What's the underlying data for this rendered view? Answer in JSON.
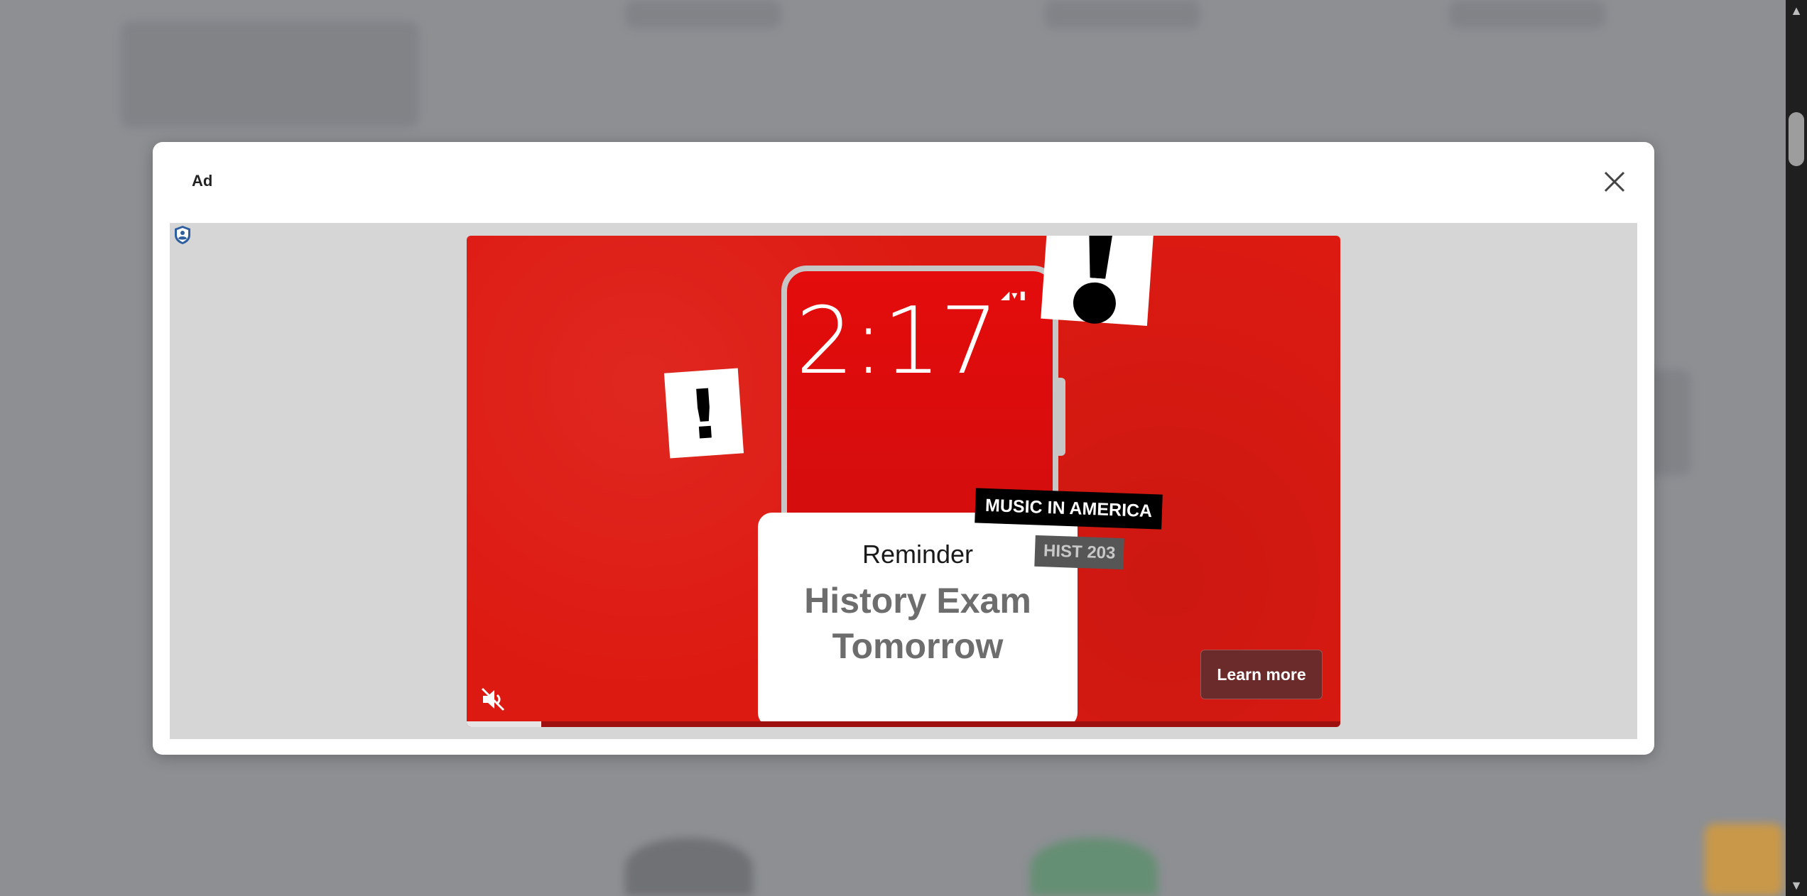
{
  "modal": {
    "title": "Ad"
  },
  "ad": {
    "clock": "2:17",
    "tag_primary": "MUSIC IN AMERICA",
    "tag_secondary": "HIST 203",
    "card_heading": "Reminder",
    "card_line1": "History Exam",
    "card_line2": "Tomorrow",
    "cta_label": "Learn more",
    "muted": true,
    "progress_fraction": 0.085
  },
  "colors": {
    "ad_red": "#dd1a12",
    "cta_bg": "#6b2b2b",
    "backdrop": "#8e9094"
  },
  "icons": [
    "close-icon",
    "shield-icon",
    "mute-icon",
    "scroll-up-icon",
    "scroll-down-icon"
  ]
}
